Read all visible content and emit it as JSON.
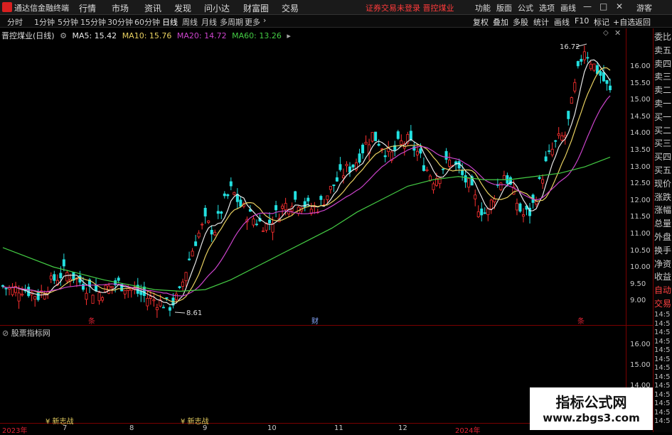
{
  "app": {
    "title": "通达信金融终端",
    "menu": [
      "行情",
      "市场",
      "资讯",
      "发现",
      "问小达",
      "财富圈",
      "交易"
    ],
    "alert": "证券交易未登录  晋控煤业",
    "right_menu": [
      "功能",
      "版面",
      "公式",
      "选项",
      "画线",
      "游客"
    ],
    "window_buttons": [
      "—",
      "□",
      "✕"
    ]
  },
  "toolbar": {
    "periods": [
      "分时",
      "1分钟",
      "5分钟",
      "15分钟",
      "30分钟",
      "60分钟",
      "日线",
      "周线",
      "月线",
      "多周期",
      "更多"
    ],
    "active_period": "日线",
    "right_buttons": [
      "复权",
      "叠加",
      "多股",
      "统计",
      "画线",
      "F10",
      "标记",
      "+自选",
      "返回"
    ]
  },
  "chart": {
    "stock_title": "晋控煤业(日线)",
    "ma": [
      {
        "label": "MA5: 15.42",
        "color": "#e8e8e8"
      },
      {
        "label": "MA10: 15.76",
        "color": "#e8d060"
      },
      {
        "label": "MA20: 14.72",
        "color": "#cc44cc"
      },
      {
        "label": "MA60: 13.26",
        "color": "#44cc44"
      }
    ],
    "high_label": "16.72",
    "low_label": "8.61",
    "y_ticks": [
      "16.00",
      "15.50",
      "15.00",
      "14.50",
      "14.00",
      "13.50",
      "13.00",
      "12.50",
      "12.00",
      "11.50",
      "11.00",
      "10.50",
      "10.00",
      "9.50",
      "9.00"
    ],
    "events": [
      "条",
      "财",
      "条"
    ],
    "colors": {
      "up": "#ff3030",
      "down": "#22e0e0",
      "bg": "#000000",
      "grid": "#7a0000"
    }
  },
  "subchart": {
    "title": "股票指标网",
    "y_ticks": [
      "16.00",
      "15.00",
      "14.00"
    ],
    "signals": [
      "¥ 新志战",
      "¥ 新志战"
    ]
  },
  "x_axis": [
    "2023年",
    "7",
    "8",
    "9",
    "10",
    "11",
    "12",
    "2024年"
  ],
  "right_panel": {
    "labels": [
      "委比",
      "卖五",
      "卖四",
      "卖三",
      "卖二",
      "卖一",
      "买一",
      "买二",
      "买三",
      "买四",
      "买五",
      "现价",
      "涨跌",
      "涨幅",
      "总量",
      "外盘",
      "换手",
      "净资",
      "收益",
      "自动",
      "交易"
    ],
    "times": [
      "14:5",
      "14:5",
      "14:5",
      "14:5",
      "14:5",
      "14:5",
      "14:5",
      "14:5",
      "14:5",
      "14:5",
      "14:5",
      "14:5",
      "14:5"
    ]
  },
  "watermark": {
    "line1": "指标公式网",
    "line2": "www.zbgs3.com"
  },
  "chart_data": {
    "type": "candlestick",
    "title": "晋控煤业(日线)",
    "ylim": [
      8.5,
      16.8
    ],
    "close_path": [
      9.3,
      9.2,
      9.25,
      9.15,
      9.0,
      9.3,
      9.55,
      9.75,
      9.6,
      9.4,
      9.2,
      9.1,
      9.25,
      9.4,
      9.3,
      9.15,
      9.0,
      8.9,
      8.8,
      8.7,
      9.0,
      10.0,
      10.8,
      11.3,
      11.0,
      11.8,
      12.3,
      11.8,
      11.5,
      11.3,
      11.2,
      11.5,
      11.8,
      12.0,
      11.9,
      11.7,
      11.8,
      12.2,
      12.6,
      12.9,
      13.1,
      13.6,
      14.0,
      13.7,
      13.3,
      13.7,
      13.8,
      13.5,
      13.0,
      12.6,
      13.0,
      13.2,
      12.8,
      12.4,
      11.8,
      11.5,
      12.3,
      12.8,
      12.2,
      11.5,
      11.6,
      12.5,
      13.3,
      13.8,
      14.0,
      15.5,
      16.7,
      16.2,
      15.8,
      15.3
    ],
    "ma60_path": [
      10.5,
      10.2,
      9.9,
      9.7,
      9.5,
      9.35,
      9.2,
      9.15,
      9.2,
      9.5,
      9.9,
      10.3,
      10.7,
      11.1,
      11.6,
      12.0,
      12.4,
      12.6,
      12.7,
      12.6,
      12.6,
      12.7,
      12.8,
      13.0,
      13.3
    ]
  }
}
